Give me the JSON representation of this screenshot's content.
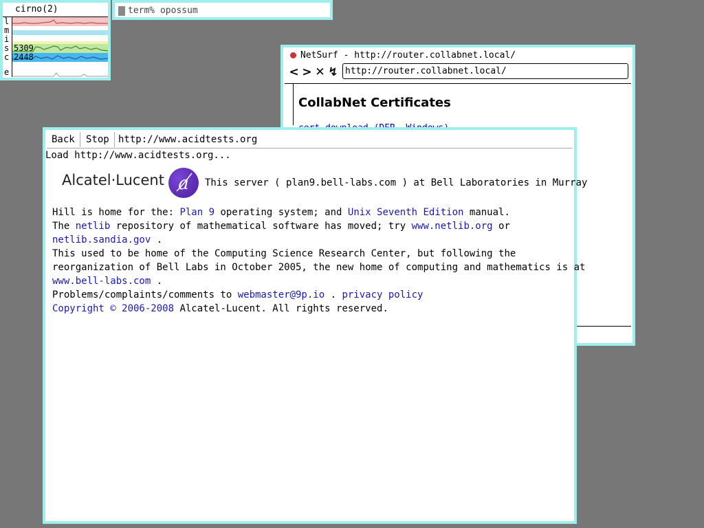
{
  "stats": {
    "title": "cirno(2)",
    "rows": [
      {
        "label": "l",
        "value": ""
      },
      {
        "label": "m",
        "value": ""
      },
      {
        "label": "i",
        "value": ""
      },
      {
        "label": "s",
        "value": "5309"
      },
      {
        "label": "c",
        "value": "2448"
      },
      {
        "label": "e",
        "value": ""
      }
    ],
    "colors": {
      "load": "#f3c4c4",
      "load_line": "#c05050",
      "memory": "#a9e2f0",
      "interrupts": "#f3f3b0",
      "syscalls": "#bfe7a3",
      "syscalls_line": "#3e8c24",
      "context": "#48b7ee",
      "context_line": "#1b5a9a",
      "ether": "#e0e0e0"
    }
  },
  "term": {
    "prompt": "term% opossum"
  },
  "netsurf": {
    "title": "NetSurf - http://router.collabnet.local/",
    "nav": {
      "back": "<",
      "forward": ">",
      "stop": "✕",
      "reload": "↯"
    },
    "url": "http://router.collabnet.local/",
    "heading": "CollabNet Certificates",
    "link": "cert download (DER, Windows)"
  },
  "mothra": {
    "toolbar": {
      "back": "Back",
      "stop": "Stop",
      "url": "http://www.acidtests.org"
    },
    "status": "Load http://www.acidtests.org...",
    "logo_text": "Alcatel·Lucent",
    "logo_mark": "a",
    "content": {
      "l1": "This server ( plan9.bell-labs.com ) at Bell Laboratories in Murray",
      "l2a": "Hill is home for the: ",
      "l2_plan9": "Plan 9",
      "l2b": " operating system; and ",
      "l2_unix": "Unix Seventh Edition",
      "l2c": " manual.",
      "l3a": "The ",
      "l3_netlib": "netlib",
      "l3b": " repository of mathematical software has moved; try ",
      "l3_netlib_org": "www.netlib.org",
      "l3c": "  or",
      "l4_sandia": "netlib.sandia.gov",
      "l4b": "  .",
      "l5": "This used to be home of the Computing Science Research Center, but following the",
      "l6": "reorganization of Bell Labs in October 2005, the new home of computing and mathematics is at",
      "l7_belllabs": "www.bell-labs.com",
      "l7b": "  .",
      "l8a": "Problems/complaints/comments to ",
      "l8_webmaster": "webmaster@9p.io",
      "l8b": "  . ",
      "l8_privacy": "privacy policy",
      "l9_copyright": "Copyright © 2006-2008",
      "l9b": " Alcatel-Lucent. All rights reserved."
    }
  }
}
